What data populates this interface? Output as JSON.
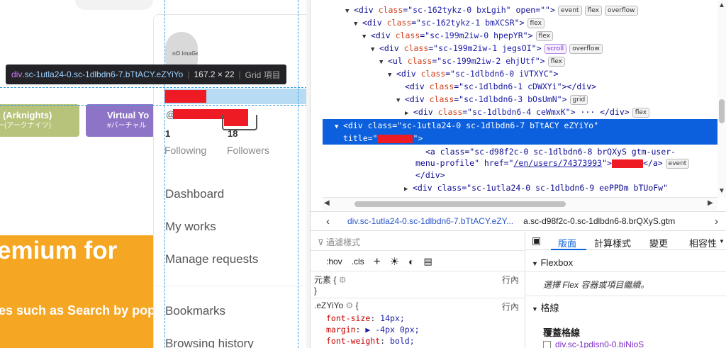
{
  "page": {
    "tags": [
      {
        "title": "t (Arknights)",
        "subtitle": "ー(アークナイツ)",
        "color": "#b7c27a"
      },
      {
        "title": "Virtual Yo",
        "subtitle": "#バーチャル",
        "color": "#8d74c6"
      }
    ],
    "premium": {
      "headline": "emium for",
      "subline": "es such as Search by popu"
    },
    "avatar_text": "nO imaGe",
    "at_prefix": "@",
    "following_count": "1",
    "followers_count": "18",
    "following_label": "Following",
    "followers_label": "Followers",
    "menu": [
      "Dashboard",
      "My works",
      "Manage requests",
      "Bookmarks",
      "Browsing history"
    ],
    "inspector": {
      "tag": "div",
      "cls": ".sc-1utla24-0.sc-1dlbdn6-7.bTtACY.eZYiYo",
      "dims": "167.2 × 22",
      "kind": "Grid 項目"
    }
  },
  "devtools": {
    "tree": [
      {
        "indent": 0,
        "open": true,
        "tag": "div",
        "attr": "class",
        "val": "sc-162tykz-0 bxLgih",
        "extra": " open=\"\">",
        "badges": [
          "event",
          "flex",
          "overflow"
        ]
      },
      {
        "indent": 1,
        "open": true,
        "tag": "div",
        "attr": "class",
        "val": "sc-162tykz-1 bmXCSR",
        "extra": ">",
        "badges": [
          "flex"
        ]
      },
      {
        "indent": 2,
        "open": true,
        "tag": "div",
        "attr": "class",
        "val": "sc-199m2iw-0 hpepYR",
        "extra": ">",
        "badges": [
          "flex"
        ]
      },
      {
        "indent": 3,
        "open": true,
        "tag": "div",
        "attr": "class",
        "val": "sc-199m2iw-1 jegsOI",
        "extra": ">",
        "badges": [
          "scroll",
          "overflow"
        ]
      },
      {
        "indent": 4,
        "open": true,
        "tag": "ul",
        "attr": "class",
        "val": "sc-199m2iw-2 ehjUtf",
        "extra": ">",
        "badges": [
          "flex"
        ]
      },
      {
        "indent": 5,
        "open": true,
        "tag": "div",
        "attr": "class",
        "val": "sc-1dlbdn6-0 iVTXYC",
        "extra": ">",
        "badges": []
      },
      {
        "indent": 6,
        "open": null,
        "tag": "div",
        "attr": "class",
        "val": "sc-1dlbdn6-1 cDWXYi",
        "extra": "></div>",
        "badges": []
      },
      {
        "indent": 6,
        "open": true,
        "tag": "div",
        "attr": "class",
        "val": "sc-1dlbdn6-3 bOsUmN",
        "extra": ">",
        "badges": [
          "grid"
        ]
      },
      {
        "indent": 7,
        "open": false,
        "tag": "div",
        "attr": "class",
        "val": "sc-1dlbdn6-4 ceWmxK",
        "extra": "> ··· </div>",
        "badges": [
          "flex"
        ]
      }
    ],
    "selected": {
      "line1": "<div class=\"sc-1utla24-0 sc-1dlbdn6-7 bTtACY eZYiYo\"",
      "line2_prefix": "title=\"",
      "line2_suffix": "\">"
    },
    "anchor": {
      "line1_a": "<a class=\"sc-d98f2c-0 sc-1dlbdn6-8 brQXyS gtm-user-",
      "line2_a": "menu-profile\" href=\"",
      "href": "/en/users/74373993",
      "line2_b": "\">",
      "line2_c": "</a>",
      "badge": "event"
    },
    "close_div": "</div>",
    "next_line": "<div class=\"sc-1utla24-0 sc-1dlbdn6-9 eePPDm bTUoFw\"",
    "breadcrumb": {
      "item1": "div.sc-1utla24-0.sc-1dlbdn6-7.bTtACY.eZY...",
      "item2": "a.sc-d98f2c-0.sc-1dlbdn6-8.brQXyS.gtm"
    },
    "styles": {
      "filter_placeholder": "過濾樣式",
      "hov": ":hov",
      "cls": ".cls",
      "element_rule": "元素 {",
      "element_close": "}",
      "inline_label": "行內",
      "rule_selector": ".eZYiYo",
      "rule_open": "{",
      "props": [
        {
          "name": "font-size",
          "value": "14px;"
        },
        {
          "name": "margin",
          "value": "▶ -4px 0px;"
        },
        {
          "name": "font-weight",
          "value": "bold;"
        }
      ]
    },
    "layout": {
      "tabs": [
        "版面",
        "計算樣式",
        "變更",
        "相容性"
      ],
      "active_tab": "版面",
      "flexbox": "Flexbox",
      "flex_hint": "選擇 Flex 容器或項目繼續。",
      "grid": "格線",
      "overlay_grid": "覆蓋格線",
      "grid_item": "div.sc-1pdisn0-0.biNioS"
    }
  },
  "colors": {
    "selection": "#0c60dd",
    "highlight": "#b7dbf3",
    "premium": "#f5a623",
    "redaction": "#ee1b24"
  }
}
